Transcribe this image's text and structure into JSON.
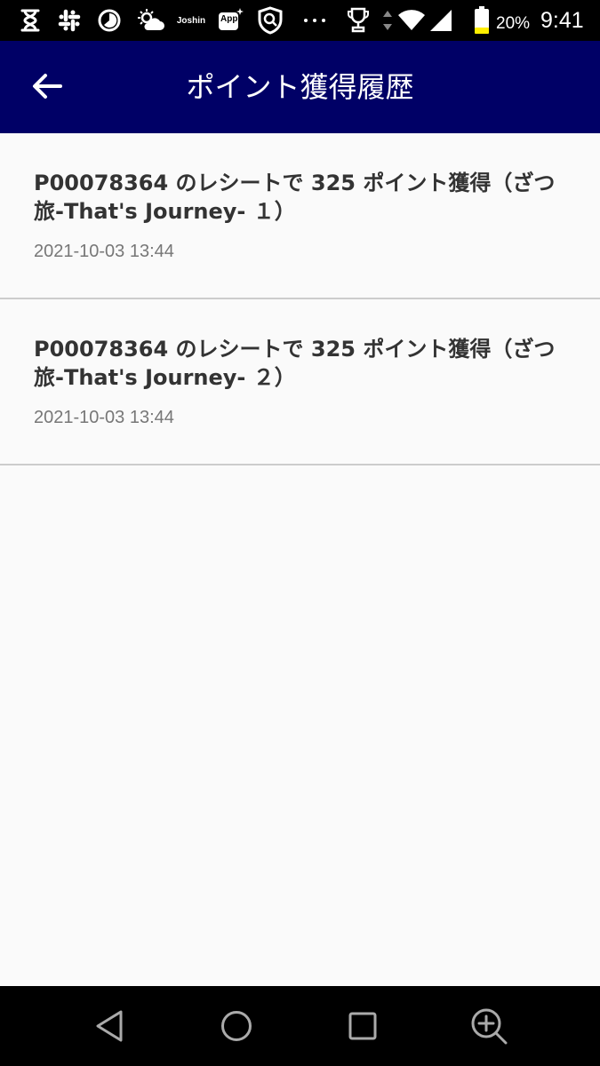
{
  "status_bar": {
    "icons": [
      "hourglass-icon",
      "slack-icon",
      "timer-icon",
      "weather-icon",
      "joshin-icon",
      "app-icon",
      "shield-search-icon",
      "more-dots-icon",
      "trophy-icon",
      "data-arrows-icon",
      "wifi-icon",
      "signal-icon",
      "battery-icon"
    ],
    "joshin_label": "Joshin",
    "app_label": "App",
    "battery_percent": "20%",
    "time": "9:41",
    "battery_color": "#ffee00"
  },
  "app_bar": {
    "title": "ポイント獲得履歴",
    "background": "#000066",
    "back_icon": "arrow-left-icon"
  },
  "history": {
    "items": [
      {
        "title": "P00078364 のレシートで 325 ポイント獲得（ざつ旅-That's Journey- １）",
        "date": "2021-10-03 13:44"
      },
      {
        "title": "P00078364 のレシートで 325 ポイント獲得（ざつ旅-That's Journey- ２）",
        "date": "2021-10-03 13:44"
      }
    ]
  },
  "nav_bar": {
    "icons": [
      "back-triangle-icon",
      "home-circle-icon",
      "recents-square-icon",
      "zoom-in-icon"
    ]
  }
}
